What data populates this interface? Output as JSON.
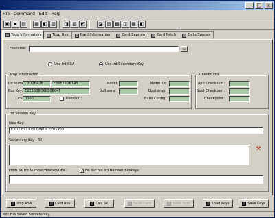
{
  "menu": [
    "File",
    "Command",
    "Edit",
    "Help"
  ],
  "title_buttons": [
    "_",
    "□",
    "x"
  ],
  "tabs": [
    {
      "label": "Tcop Information"
    },
    {
      "label": "Tcop Hex"
    },
    {
      "label": "Card Information"
    },
    {
      "label": "Card Eeprom"
    },
    {
      "label": "Card Patch"
    },
    {
      "label": "Data Spaces"
    }
  ],
  "filename": {
    "label": "Filename:",
    "value": ""
  },
  "radio": {
    "option1": "Use Ird RSA",
    "option2": "Use Ird Secondary Key",
    "selected": 2
  },
  "tcop_info": {
    "title": "Tcop Information",
    "ird_number_label": "Ird Number:",
    "ird_number_value": "C3D2BA2B",
    "ird_number_value2": "F38E22D6143",
    "box_keys_label": "Box Keys:",
    "box_keys_value": "E2E3BB8D6BE0B04F",
    "ofic_label": "OFIC:",
    "ofic_value": "0000",
    "user_label": "User0003",
    "model_label": "Model:",
    "model_value": "",
    "software_label": "Software:",
    "software_value": "",
    "model_id_label": "Model ID:",
    "model_id_value": "",
    "bootstrap_label": "Bootstrap:",
    "bootstrap_value": "",
    "build_config_label": "Build Config:",
    "build_config_value": ""
  },
  "checksums": {
    "title": "Checksums",
    "app_label": "App Checksum:",
    "app_value": "",
    "boot_label": "Boot Checksum:",
    "boot_value": "",
    "checkpoint_label": "Checkpoint:",
    "checkpoint_value": ""
  },
  "session_key": {
    "title": "Ird Session Key",
    "idea_label": "Idea Key:",
    "idea_value": "E3D2 BL23 E63 BA08 EF05 B00",
    "secondary_label": "Secondary Key - SK:",
    "secondary_value": "",
    "from_label": "From SK Ird Number/Boxkey/OFIC:",
    "fill_label": "Fill out old Ird Number/Boxkeys",
    "fill_checked": true,
    "from_value": ""
  },
  "buttons": {
    "tcop_rsa": "Tcop RSA",
    "card_rsa": "Card Rsa",
    "calc_sk": "Calc SK",
    "save_card": "Save Card",
    "save_tcop": "Save Tcop",
    "load_keys": "Load Keys",
    "save_keys": "Save Keys"
  },
  "status": "Key File Saved Successfully."
}
